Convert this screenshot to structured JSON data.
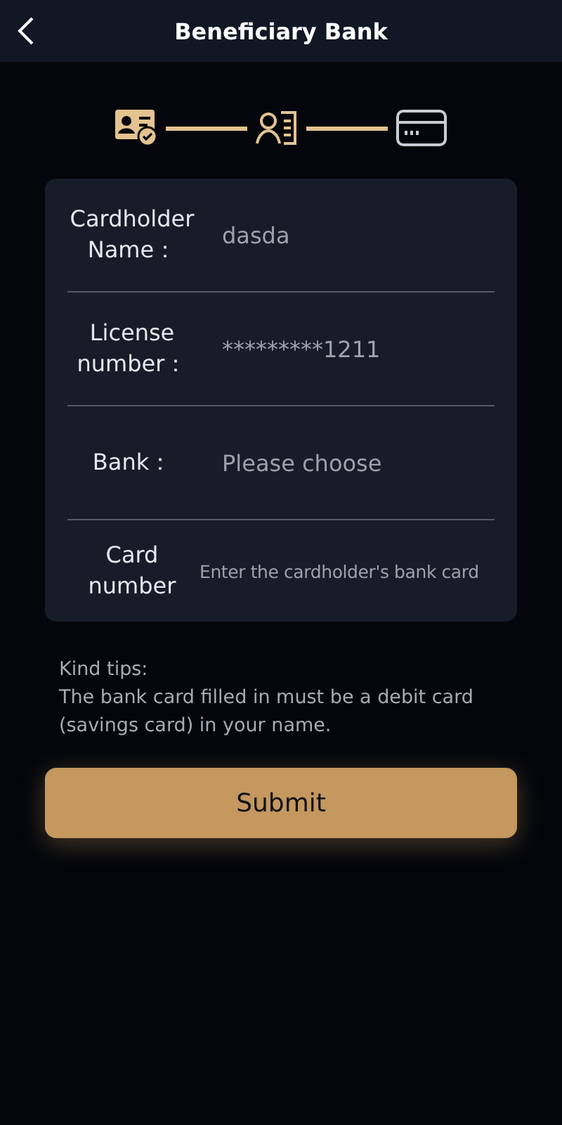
{
  "header": {
    "title": "Beneficiary Bank"
  },
  "steps": [
    {
      "kind": "id-card",
      "done": true
    },
    {
      "kind": "profile",
      "done": true
    },
    {
      "kind": "bank-card",
      "done": false
    }
  ],
  "form": [
    {
      "kind": "input",
      "label": "Cardholder Name：",
      "value": "dasda"
    },
    {
      "kind": "input",
      "label": "License number：",
      "value": "*********1211"
    },
    {
      "kind": "select",
      "label": "Bank：",
      "placeholder": "Please choose"
    },
    {
      "kind": "input",
      "label": "Card number",
      "placeholder": "Enter the cardholder's bank card"
    }
  ],
  "tips": {
    "title": "Kind tips:",
    "text": "The bank card filled in must be a debit card (savings card) in your name."
  },
  "submit": "Submit"
}
